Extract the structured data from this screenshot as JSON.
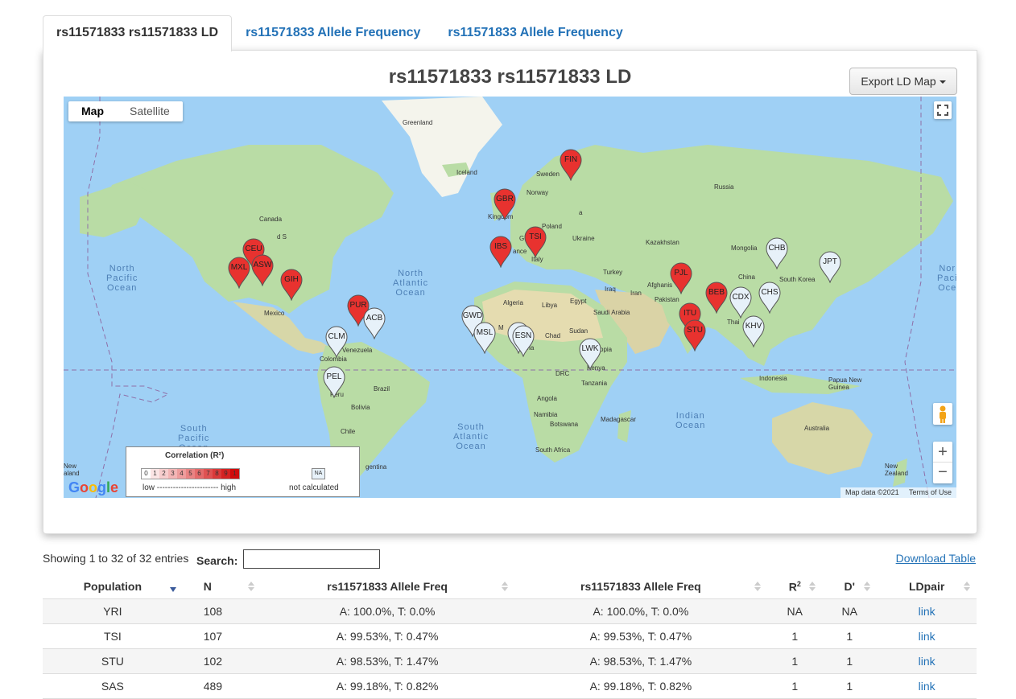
{
  "tabs": [
    {
      "label": "rs11571833 rs11571833 LD",
      "active": true
    },
    {
      "label": "rs11571833 Allele Frequency",
      "active": false
    },
    {
      "label": "rs11571833 Allele Frequency",
      "active": false
    }
  ],
  "panel": {
    "title": "rs11571833 rs11571833 LD",
    "export_label": "Export LD Map"
  },
  "map": {
    "type_buttons": [
      "Map",
      "Satellite"
    ],
    "selected_type": "Map",
    "fullscreen_icon": "fullscreen-icon",
    "pegman_icon": "pegman-icon",
    "zoom_in": "+",
    "zoom_out": "−",
    "google_logo": "Google",
    "map_data": "Map data ©2021",
    "terms": "Terms of Use",
    "land_labels": [
      {
        "text": "Greenland"
      },
      {
        "text": "Iceland"
      },
      {
        "text": "Sweden"
      },
      {
        "text": "Norway"
      },
      {
        "text": "Russia"
      },
      {
        "text": "Canada"
      },
      {
        "text": "Kingdom"
      },
      {
        "text": "Poland"
      },
      {
        "text": "Ukraine"
      },
      {
        "text": "Kazakhstan"
      },
      {
        "text": "Mongolia"
      },
      {
        "text": "ance"
      },
      {
        "text": "Italy"
      },
      {
        "text": "Turkey"
      },
      {
        "text": "China"
      },
      {
        "text": "South Korea"
      },
      {
        "text": "Mexico"
      },
      {
        "text": "Algeria"
      },
      {
        "text": "Libya"
      },
      {
        "text": "Egypt"
      },
      {
        "text": "Iraq"
      },
      {
        "text": "Iran"
      },
      {
        "text": "Afghanis"
      },
      {
        "text": "Pakistan"
      },
      {
        "text": "Saudi Arabia"
      },
      {
        "text": "Sudan"
      },
      {
        "text": "Chad"
      },
      {
        "text": "opia"
      },
      {
        "text": "Venezuela"
      },
      {
        "text": "Colombia"
      },
      {
        "text": "Kenya"
      },
      {
        "text": "DRC"
      },
      {
        "text": "Tanzania"
      },
      {
        "text": "Brazil"
      },
      {
        "text": "Peru"
      },
      {
        "text": "Bolivia"
      },
      {
        "text": "Angola"
      },
      {
        "text": "Namibia"
      },
      {
        "text": "Botswana"
      },
      {
        "text": "Madagascar"
      },
      {
        "text": "South Africa"
      },
      {
        "text": "Chile"
      },
      {
        "text": "gentina"
      },
      {
        "text": "Indonesia"
      },
      {
        "text": "Papua New\nGuinea"
      },
      {
        "text": "Australia"
      },
      {
        "text": "New\nZealand"
      },
      {
        "text": "New\naland"
      },
      {
        "text": "Thai"
      },
      {
        "text": "d S"
      },
      {
        "text": "eria"
      },
      {
        "text": "M"
      },
      {
        "text": "G"
      },
      {
        "text": "a"
      }
    ],
    "ocean_labels": [
      {
        "text": "North\nPacific\nOcean"
      },
      {
        "text": "North\nAtlantic\nOcean"
      },
      {
        "text": "South\nPacific\nOcean"
      },
      {
        "text": "South\nAtlantic\nOcean"
      },
      {
        "text": "Indian\nOcean"
      },
      {
        "text": "Nor\nPaci\nOce"
      }
    ],
    "markers": [
      {
        "label": "FIN",
        "color": "#e8322f"
      },
      {
        "label": "GBR",
        "color": "#e8322f"
      },
      {
        "label": "TSI",
        "color": "#e8322f"
      },
      {
        "label": "IBS",
        "color": "#e8322f"
      },
      {
        "label": "CEU",
        "color": "#e8322f"
      },
      {
        "label": "ASW",
        "color": "#e8322f"
      },
      {
        "label": "MXL",
        "color": "#e8322f"
      },
      {
        "label": "GIH",
        "color": "#e8322f"
      },
      {
        "label": "PUR",
        "color": "#e8322f"
      },
      {
        "label": "ACB",
        "color": "#e7f1f9"
      },
      {
        "label": "CLM",
        "color": "#e7f1f9"
      },
      {
        "label": "PEL",
        "color": "#e7f1f9"
      },
      {
        "label": "GWD",
        "color": "#e7f1f9"
      },
      {
        "label": "MSL",
        "color": "#e7f1f9"
      },
      {
        "label": "",
        "color": "#e7f1f9"
      },
      {
        "label": "ESN",
        "color": "#e7f1f9"
      },
      {
        "label": "LWK",
        "color": "#e7f1f9"
      },
      {
        "label": "PJL",
        "color": "#e8322f"
      },
      {
        "label": "BEB",
        "color": "#e8322f"
      },
      {
        "label": "ITU",
        "color": "#e8322f"
      },
      {
        "label": "STU",
        "color": "#e8322f"
      },
      {
        "label": "CDX",
        "color": "#e7f1f9"
      },
      {
        "label": "CHS",
        "color": "#e7f1f9"
      },
      {
        "label": "KHV",
        "color": "#e7f1f9"
      },
      {
        "label": "CHB",
        "color": "#e7f1f9"
      },
      {
        "label": "JPT",
        "color": "#e7f1f9"
      }
    ]
  },
  "legend": {
    "title": "Correlation  (R²)",
    "scale": [
      "0",
      "1",
      "2",
      "3",
      "4",
      "5",
      "6",
      "7",
      "8",
      "9",
      "1"
    ],
    "scale_colors": [
      "#ffffff",
      "#fbe4e4",
      "#f7cdcd",
      "#f3b5b5",
      "#ee9c9c",
      "#e98383",
      "#e46a6a",
      "#df5252",
      "#da3a3a",
      "#d52222",
      "#d00a0a"
    ],
    "low": "low ----------------------- high",
    "na_box": "NA",
    "na_label": "not calculated"
  },
  "table_controls": {
    "info": "Showing 1 to 32 of 32 entries",
    "search_label": "Search:",
    "search_value": "",
    "download": "Download Table"
  },
  "table": {
    "columns": [
      "Population",
      "N",
      "rs11571833 Allele Freq",
      "rs11571833 Allele Freq",
      "R",
      "D'",
      "LDpair"
    ],
    "r_superscript": "2",
    "rows": [
      [
        "YRI",
        "108",
        "A: 100.0%, T: 0.0%",
        "A: 100.0%, T: 0.0%",
        "NA",
        "NA",
        "link"
      ],
      [
        "TSI",
        "107",
        "A: 99.53%, T: 0.47%",
        "A: 99.53%, T: 0.47%",
        "1",
        "1",
        "link"
      ],
      [
        "STU",
        "102",
        "A: 98.53%, T: 1.47%",
        "A: 98.53%, T: 1.47%",
        "1",
        "1",
        "link"
      ],
      [
        "SAS",
        "489",
        "A: 99.18%, T: 0.82%",
        "A: 99.18%, T: 0.82%",
        "1",
        "1",
        "link"
      ]
    ]
  }
}
